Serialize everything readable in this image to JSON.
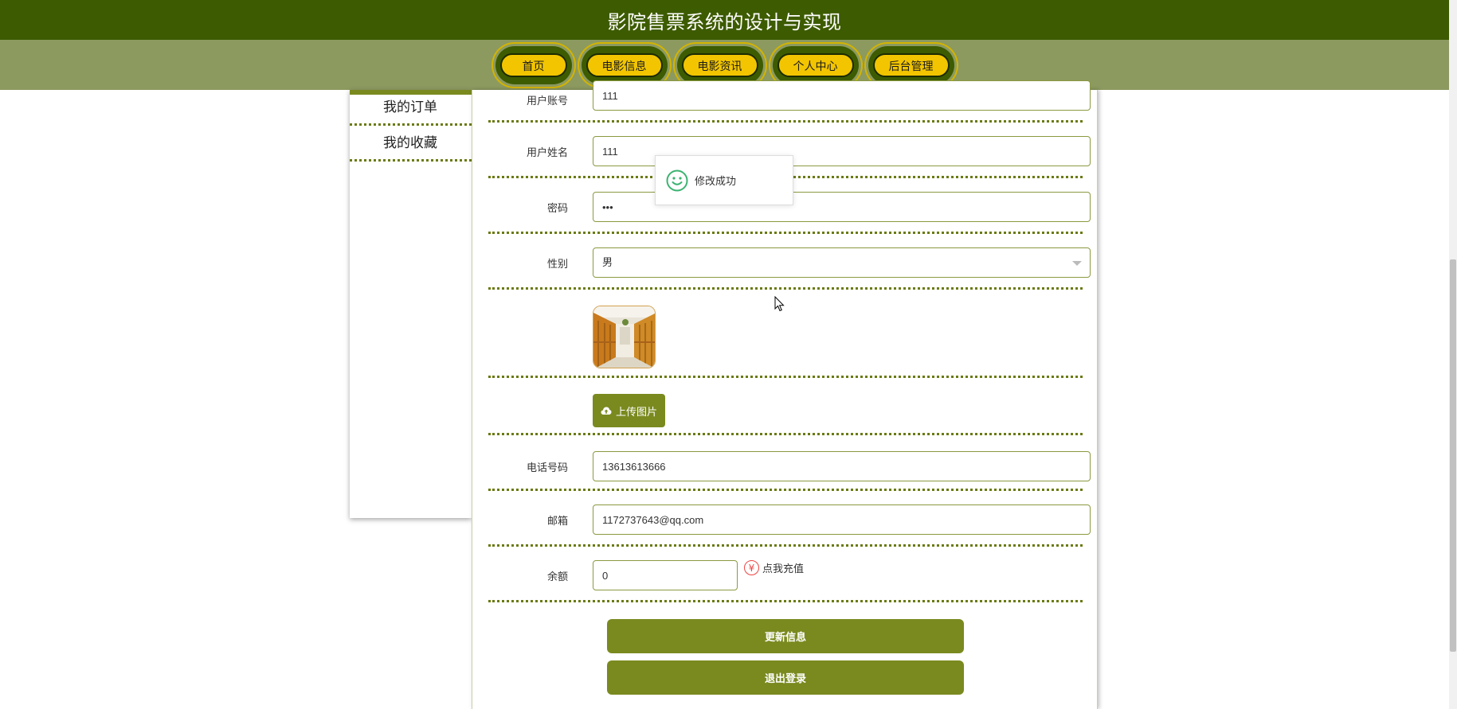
{
  "header": {
    "title": "影院售票系统的设计与实现"
  },
  "nav": {
    "items": [
      {
        "label": "首页"
      },
      {
        "label": "电影信息"
      },
      {
        "label": "电影资讯"
      },
      {
        "label": "个人中心"
      },
      {
        "label": "后台管理"
      }
    ]
  },
  "sidebar": {
    "items": [
      {
        "label": "我的订单"
      },
      {
        "label": "我的收藏"
      }
    ]
  },
  "form": {
    "username": {
      "label": "用户账号",
      "value": "111"
    },
    "realname": {
      "label": "用户姓名",
      "value": "111"
    },
    "password": {
      "label": "密码",
      "value": "•••"
    },
    "gender": {
      "label": "性别",
      "value": "男"
    },
    "upload_label": "上传图片",
    "phone": {
      "label": "电话号码",
      "value": "13613613666"
    },
    "email": {
      "label": "邮箱",
      "value": "1172737643@qq.com"
    },
    "balance": {
      "label": "余额",
      "value": "0",
      "recharge_label": "点我充值",
      "recharge_symbol": "¥"
    },
    "update_label": "更新信息",
    "logout_label": "退出登录"
  },
  "toast": {
    "message": "修改成功"
  },
  "colors": {
    "header_bg": "#3d5b00",
    "nav_bg": "#8c9a60",
    "pill": "#f2c500",
    "accent": "#7a8a1f"
  }
}
